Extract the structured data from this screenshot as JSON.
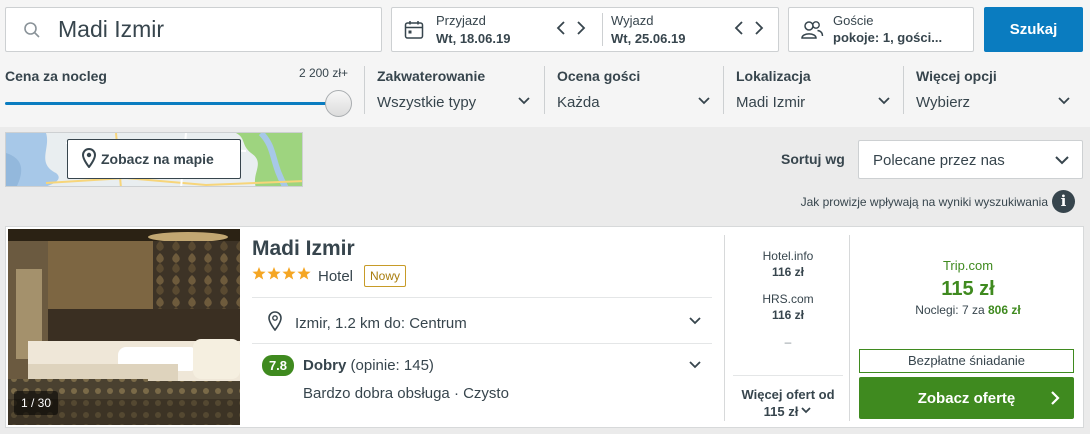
{
  "search": {
    "value": "Madi Izmir",
    "icon": "search-icon"
  },
  "dates": {
    "checkin_label": "Przyjazd",
    "checkin_value": "Wt, 18.06.19",
    "checkout_label": "Wyjazd",
    "checkout_value": "Wt, 25.06.19"
  },
  "guests": {
    "label": "Goście",
    "value": "pokoje: 1, gości..."
  },
  "search_button": "Szukaj",
  "filters": {
    "price": {
      "label": "Cena za nocleg",
      "max": "2 200 zł+",
      "level": 1.0
    },
    "accommodation": {
      "label": "Zakwaterowanie",
      "value": "Wszystkie typy"
    },
    "rating": {
      "label": "Ocena gości",
      "value": "Każda"
    },
    "location": {
      "label": "Lokalizacja",
      "value": "Madi Izmir"
    },
    "more": {
      "label": "Więcej opcji",
      "value": "Wybierz"
    }
  },
  "map": {
    "button": "Zobacz na mapie"
  },
  "sort": {
    "label": "Sortuj wg",
    "value": "Polecane przez nas"
  },
  "commission_text": "Jak prowizje wpływają na wyniki wyszukiwania",
  "result": {
    "image_counter": "1 / 30",
    "name": "Madi Izmir",
    "stars": 4,
    "type": "Hotel",
    "badge": "Nowy",
    "location": "Izmir, 1.2 km do: Centrum",
    "rating_score": "7.8",
    "rating_label": "Dobry",
    "rating_count": "(opinie: 145)",
    "rating_tags": "Bardzo dobra obsługa · Czysto",
    "other_offers": [
      {
        "site": "Hotel.info",
        "price": "116 zł"
      },
      {
        "site": "HRS.com",
        "price": "116 zł"
      }
    ],
    "other_offers_dash": "–",
    "more_offers_line1": "Więcej ofert od",
    "more_offers_line2": "115 zł",
    "best": {
      "site": "Trip.com",
      "price": "115 zł",
      "nights_prefix": "Noclegi: 7 za",
      "nights_total": "806 zł",
      "breakfast": "Bezpłatne śniadanie",
      "cta": "Zobacz ofertę"
    }
  },
  "colors": {
    "accent_blue": "#0a7cc0",
    "deal_green": "#3f8a1f",
    "star": "#f5a623",
    "badge_gold": "#c79b28"
  }
}
